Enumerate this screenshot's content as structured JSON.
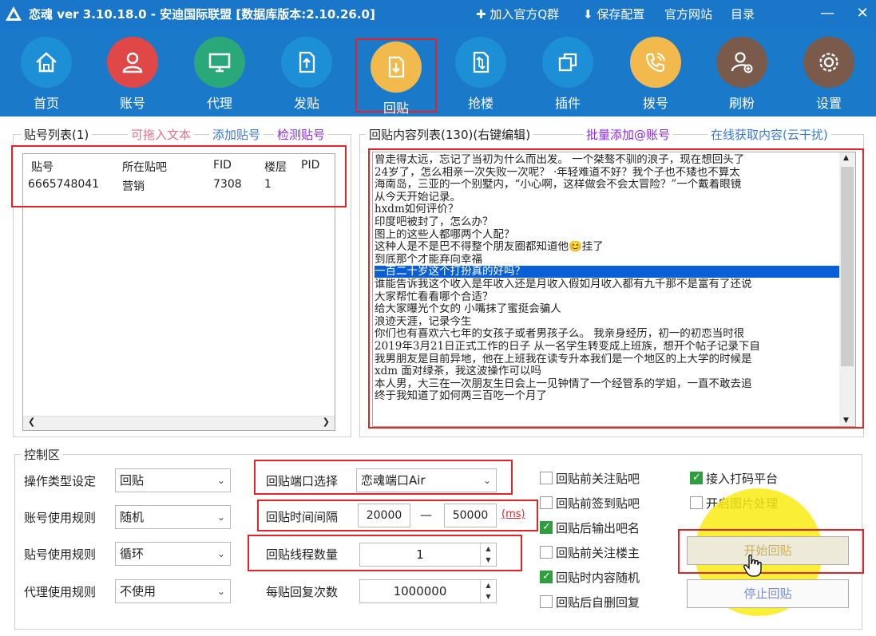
{
  "window": {
    "title": "恋魂 ver 3.10.18.0 - 安迪国际联盟 [数据库版本:2.10.26.0]",
    "menu": [
      "✚ 加入官方Q群",
      "⬇ 保存配置",
      "官方网站",
      "目录"
    ],
    "minimize": "—",
    "close": "✕"
  },
  "colors": {
    "titlebar": "#1976c8",
    "toolbar": "#1a79c9",
    "highlight": "#e0242a",
    "link_pink": "#e0708a",
    "link_blue": "#3a78c8",
    "link_purple": "#8a2be2",
    "selection": "#0a5fd6"
  },
  "toolbar": [
    {
      "label": "首页",
      "icon": "home-icon",
      "color": "#1d8fd6"
    },
    {
      "label": "账号",
      "icon": "user-icon",
      "color": "#e04848"
    },
    {
      "label": "代理",
      "icon": "monitor-icon",
      "color": "#2aa87a"
    },
    {
      "label": "发贴",
      "icon": "upload-file-icon",
      "color": "#1d8fd6"
    },
    {
      "label": "回贴",
      "icon": "download-file-icon",
      "color": "#f2b94c",
      "active": true
    },
    {
      "label": "抢楼",
      "icon": "transfer-file-icon",
      "color": "#1d8fd6"
    },
    {
      "label": "插件",
      "icon": "copy-icon",
      "color": "#1d8fd6"
    },
    {
      "label": "拨号",
      "icon": "phone-icon",
      "color": "#f2b94c"
    },
    {
      "label": "刷粉",
      "icon": "add-user-icon",
      "color": "#7a5a4a"
    },
    {
      "label": "设置",
      "icon": "gear-icon",
      "color": "#7a5a4a"
    }
  ],
  "accounts_panel": {
    "title": "贴号列表(1)",
    "links": [
      "可拖入文本",
      "添加贴号",
      "检测贴号"
    ],
    "columns": [
      "贴号",
      "所在贴吧",
      "FID",
      "楼层",
      "PID"
    ],
    "rows": [
      [
        "6665748041",
        "营销",
        "7308",
        "1",
        ""
      ]
    ]
  },
  "content_panel": {
    "title": "回贴内容列表(130)(右键编辑)",
    "links": [
      "批量添加@账号",
      "在线获取内容(云干扰)"
    ],
    "lines": [
      "曾走得太远，忘记了当初为什么而出发。 一个桀骜不驯的浪子，现在想回头了",
      "24岁了，怎么相亲一次失败一次呢？ ·年轻难道不好？我个子也不矮也不算太",
      "海南岛，三亚的一个别墅内，“小心啊，这样做会不会太冒险？”一个戴着眼镜",
      "从今天开始记录。",
      "hxdm如何评价？",
      "印度吧被封了，怎么办？",
      "图上的这些人都哪两个人配？",
      "这种人是不是巴不得整个朋友圈都知道他😊挂了",
      "到底那个才能弃向幸福",
      "一百二十岁这个打扮真的好吗？",
      "谁能告诉我这个收入是年收入还是月收入假如月收入都有九千那不是富有了还说",
      "大家帮忙看看哪个合适？",
      "给大家曝光个女的 小嘴抹了蜜挺会骗人",
      "浪迹天涯，记录今生",
      "你们也有喜欢六七年的女孩子或者男孩子么。 我亲身经历，初一的初恋当时很",
      "2019年3月21日正式工作的日子 从一名学生转变成上班族，想开个帖子记录下自",
      "我男朋友是目前异地，他在上班我在读专升本我们是一个地区的上大学的时候是",
      "xdm 面对绿茶，我这波操作可以吗",
      "本人男，大三在一次朋友生日会上一见钟情了一个经管系的学姐，一直不敢去追",
      "终于我知道了如何两三百吃一个月了"
    ],
    "selected_index": 9
  },
  "control": {
    "title": "控制区",
    "rules": [
      {
        "label": "操作类型设定",
        "value": "回贴"
      },
      {
        "label": "账号使用规则",
        "value": "随机"
      },
      {
        "label": "贴号使用规则",
        "value": "循环"
      },
      {
        "label": "代理使用规则",
        "value": "不使用"
      }
    ],
    "port_label": "回贴端口选择",
    "port_value": "恋魂端口Air",
    "interval_label": "回贴时间间隔",
    "interval_min": "20000",
    "interval_dash": "—",
    "interval_max": "50000",
    "interval_unit": "(ms)",
    "threads_label": "回贴线程数量",
    "threads_value": "1",
    "replies_label": "每贴回复次数",
    "replies_value": "1000000",
    "checkboxes": [
      {
        "label": "回贴前关注贴吧",
        "checked": false
      },
      {
        "label": "回贴前签到贴吧",
        "checked": false
      },
      {
        "label": "回贴后输出吧名",
        "checked": true
      },
      {
        "label": "回贴前关注楼主",
        "checked": false
      },
      {
        "label": "回贴时内容随机",
        "checked": true
      },
      {
        "label": "回贴后自删回复",
        "checked": false
      }
    ],
    "checkboxes_right": [
      {
        "label": "接入打码平台",
        "checked": true
      },
      {
        "label": "开启图片处理",
        "checked": false
      }
    ],
    "start_button": "开始回贴",
    "stop_button": "停止回贴"
  }
}
